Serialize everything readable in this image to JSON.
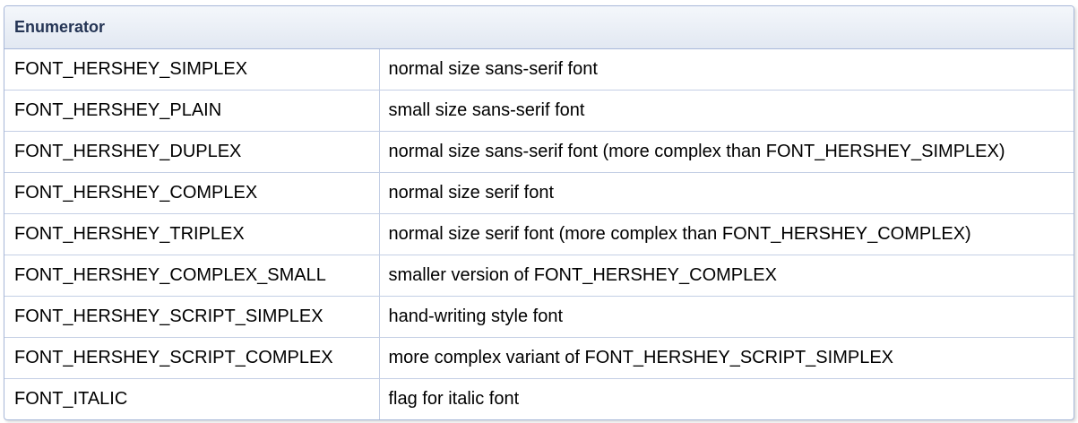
{
  "table": {
    "header": "Enumerator",
    "rows": [
      {
        "name": "FONT_HERSHEY_SIMPLEX",
        "description": "normal size sans-serif font"
      },
      {
        "name": "FONT_HERSHEY_PLAIN",
        "description": "small size sans-serif font"
      },
      {
        "name": "FONT_HERSHEY_DUPLEX",
        "description": "normal size sans-serif font (more complex than FONT_HERSHEY_SIMPLEX)"
      },
      {
        "name": "FONT_HERSHEY_COMPLEX",
        "description": "normal size serif font"
      },
      {
        "name": "FONT_HERSHEY_TRIPLEX",
        "description": "normal size serif font (more complex than FONT_HERSHEY_COMPLEX)"
      },
      {
        "name": "FONT_HERSHEY_COMPLEX_SMALL",
        "description": "smaller version of FONT_HERSHEY_COMPLEX"
      },
      {
        "name": "FONT_HERSHEY_SCRIPT_SIMPLEX",
        "description": "hand-writing style font"
      },
      {
        "name": "FONT_HERSHEY_SCRIPT_COMPLEX",
        "description": "more complex variant of FONT_HERSHEY_SCRIPT_SIMPLEX"
      },
      {
        "name": "FONT_ITALIC",
        "description": "flag for italic font"
      }
    ]
  }
}
